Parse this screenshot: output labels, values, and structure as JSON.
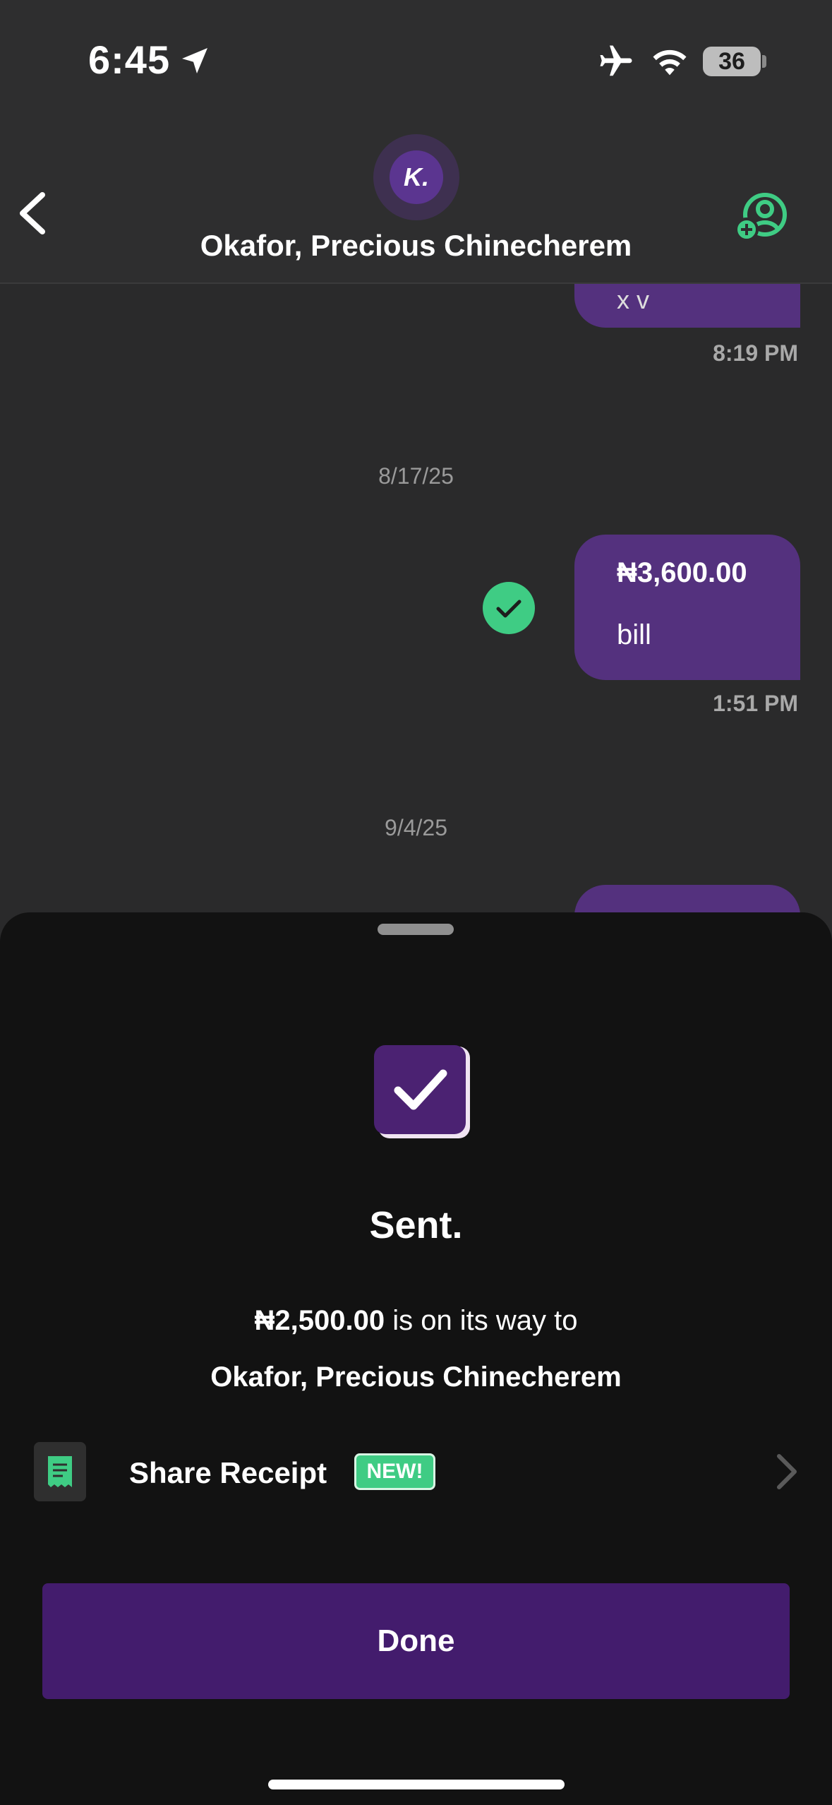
{
  "status_bar": {
    "time": "6:45",
    "battery": "36",
    "icons": [
      "location-arrow-icon",
      "airplane-icon",
      "wifi-icon",
      "battery-icon"
    ]
  },
  "header": {
    "avatar_text": "K.",
    "contact_name": "Okafor, Precious Chinecherem",
    "icons": [
      "back-chevron-icon",
      "add-contact-icon"
    ]
  },
  "chat": {
    "partial_message_text": "x v",
    "messages": [
      {
        "time": "8:19 PM"
      },
      {
        "date": "8/17/25",
        "amount": "₦3,600.00",
        "note": "bill",
        "time": "1:51 PM",
        "status": "completed"
      },
      {
        "date": "9/4/25"
      }
    ]
  },
  "sheet": {
    "title": "Sent.",
    "amount": "₦2,500.00",
    "message_suffix": " is on its way to",
    "recipient": "Okafor, Precious Chinecherem",
    "share_label": "Share Receipt",
    "new_badge": "NEW!",
    "done_label": "Done"
  },
  "colors": {
    "background": "#2a2a2b",
    "sheet": "#121212",
    "bubble": "#54317e",
    "accent_green": "#3fcc84",
    "button_purple": "#431c6d"
  }
}
